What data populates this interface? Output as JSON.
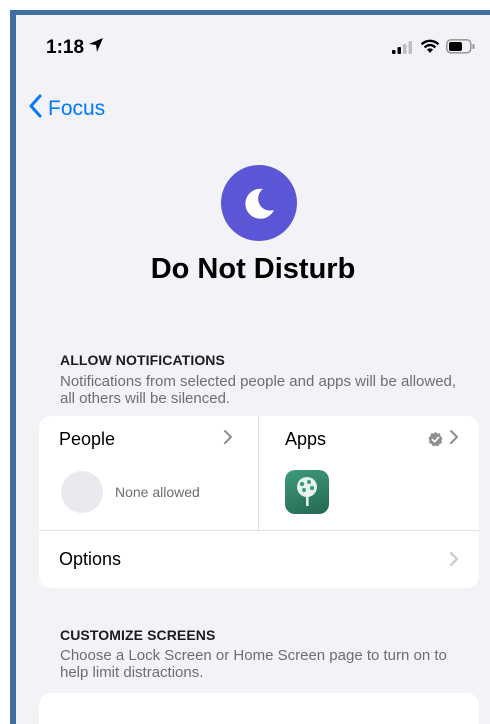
{
  "status_bar": {
    "time": "1:18"
  },
  "nav": {
    "back_label": "Focus"
  },
  "page": {
    "title": "Do Not Disturb"
  },
  "allow_notifications": {
    "header": "ALLOW NOTIFICATIONS",
    "description": "Notifications from selected people and apps will be allowed, all others will be silenced.",
    "people_label": "People",
    "people_status": "None allowed",
    "apps_label": "Apps",
    "options_label": "Options"
  },
  "customize_screens": {
    "header": "CUSTOMIZE SCREENS",
    "description": "Choose a Lock Screen or Home Screen page to turn on to help limit distractions."
  },
  "colors": {
    "accent": "#007aff",
    "focus_purple": "#5a56d6",
    "frame": "#3f6ea2"
  }
}
